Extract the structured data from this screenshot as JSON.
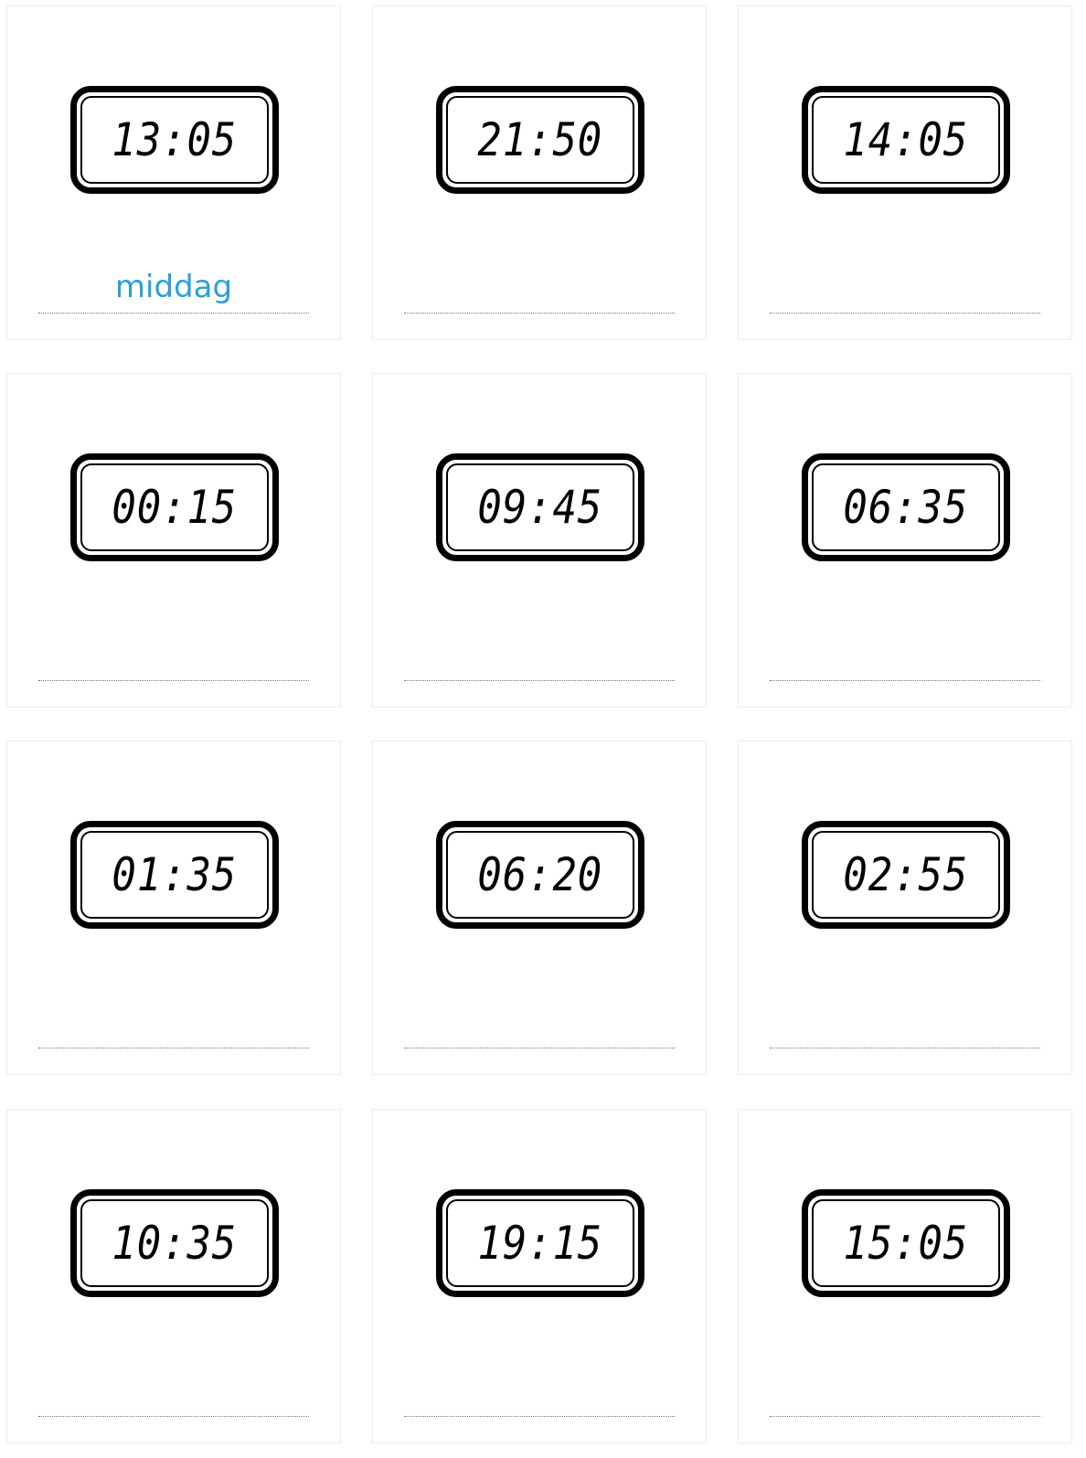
{
  "accent_color": "#2aa0d8",
  "cards": [
    {
      "time": "13:05",
      "answer": "middag"
    },
    {
      "time": "21:50",
      "answer": ""
    },
    {
      "time": "14:05",
      "answer": ""
    },
    {
      "time": "00:15",
      "answer": ""
    },
    {
      "time": "09:45",
      "answer": ""
    },
    {
      "time": "06:35",
      "answer": ""
    },
    {
      "time": "01:35",
      "answer": ""
    },
    {
      "time": "06:20",
      "answer": ""
    },
    {
      "time": "02:55",
      "answer": ""
    },
    {
      "time": "10:35",
      "answer": ""
    },
    {
      "time": "19:15",
      "answer": ""
    },
    {
      "time": "15:05",
      "answer": ""
    }
  ]
}
